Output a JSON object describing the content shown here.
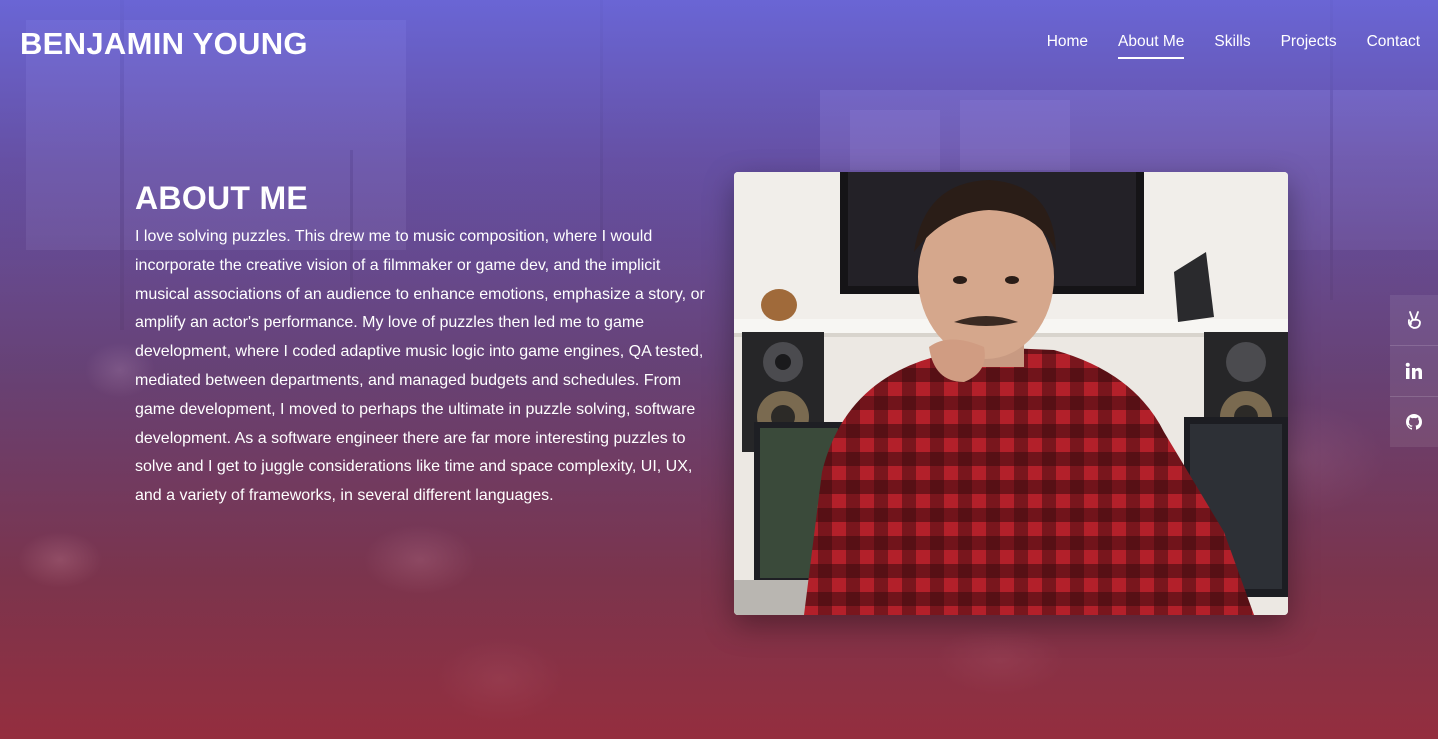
{
  "header": {
    "brand": "BENJAMIN YOUNG",
    "nav": [
      {
        "label": "Home"
      },
      {
        "label": "About Me",
        "active": true
      },
      {
        "label": "Skills"
      },
      {
        "label": "Projects"
      },
      {
        "label": "Contact"
      }
    ]
  },
  "about": {
    "title": "ABOUT ME",
    "body": "I love solving puzzles. This drew me to music composition, where I would incorporate the creative vision of a filmmaker or game dev, and the implicit musical associations of an audience to enhance emotions, emphasize a story, or amplify an actor's performance. My love of puzzles then led me to game development, where I coded adaptive music logic into game engines, QA tested, mediated between departments, and managed budgets and schedules. From game development, I moved to perhaps the ultimate in puzzle solving, software development. As a software engineer there are far more interesting puzzles to solve and I get to juggle considerations like time and space complexity, UI, UX, and a variety of frameworks, in several different languages."
  },
  "social": [
    {
      "icon": "angellist-icon"
    },
    {
      "icon": "linkedin-icon"
    },
    {
      "icon": "github-icon"
    }
  ],
  "colors": {
    "overlay_top": "#706ce6",
    "overlay_bottom": "#a83044",
    "text": "#ffffff"
  }
}
